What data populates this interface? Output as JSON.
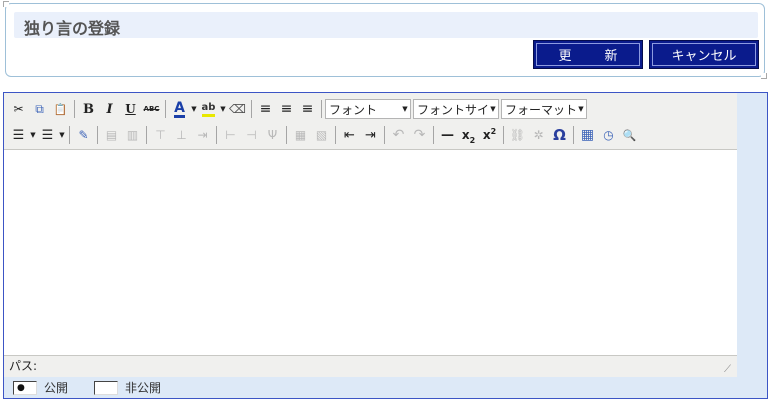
{
  "header": {
    "title": "独り言の登録",
    "update_button": "更新",
    "cancel_button": "キャンセル"
  },
  "toolbar": {
    "row1": {
      "font_select": "フォント",
      "font_size_select": "フォントサイズ",
      "format_select": "フォーマット"
    },
    "icons": {
      "cut": "✂",
      "copy": "⧉",
      "paste": "📋",
      "bold": "B",
      "italic": "I",
      "underline": "U",
      "strikethrough": "ABC",
      "font_color": "A",
      "bg_color": "ab",
      "eraser": "⌫",
      "align_left": "≡",
      "align_center": "≡",
      "align_right": "≡",
      "bullet_list": "☰",
      "numbered_list": "☰",
      "edit_html": "✎",
      "undo": "↶",
      "redo": "↷",
      "hr": "—",
      "subscript": "x",
      "superscript": "x",
      "sub_mark": "2",
      "sup_mark": "2",
      "link": "⛓",
      "unlink": "✲",
      "special_char": "Ω",
      "insert_date": "▦",
      "insert_time": "◷",
      "preview": "🔍"
    }
  },
  "editor": {
    "path_label": "パス:",
    "content": ""
  },
  "visibility": {
    "public_label": "公開",
    "private_label": "非公開",
    "selected": "公開",
    "selected_mark": "●"
  }
}
